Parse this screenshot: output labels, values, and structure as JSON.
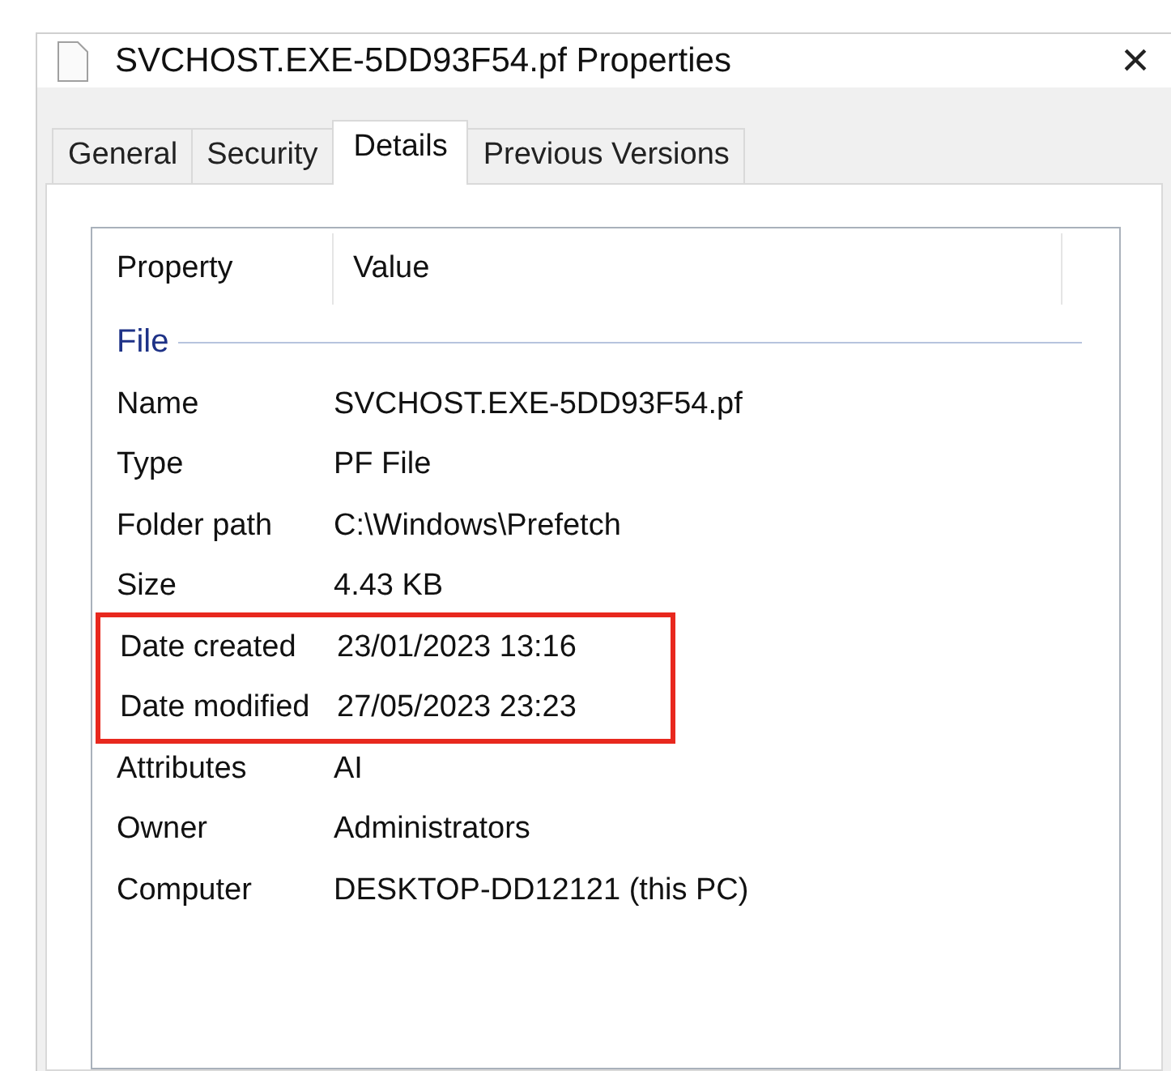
{
  "window": {
    "title": "SVCHOST.EXE-5DD93F54.pf Properties",
    "close": "×"
  },
  "tabs": [
    {
      "label": "General",
      "selected": false
    },
    {
      "label": "Security",
      "selected": false
    },
    {
      "label": "Details",
      "selected": true
    },
    {
      "label": "Previous Versions",
      "selected": false
    }
  ],
  "list": {
    "columns": [
      "Property",
      "Value"
    ],
    "group": "File",
    "rows": [
      {
        "property": "Name",
        "value": "SVCHOST.EXE-5DD93F54.pf",
        "highlighted": false
      },
      {
        "property": "Type",
        "value": "PF File",
        "highlighted": false
      },
      {
        "property": "Folder path",
        "value": "C:\\Windows\\Prefetch",
        "highlighted": false
      },
      {
        "property": "Size",
        "value": "4.43 KB",
        "highlighted": false
      },
      {
        "property": "Date created",
        "value": "23/01/2023 13:16",
        "highlighted": true
      },
      {
        "property": "Date modified",
        "value": "27/05/2023 23:23",
        "highlighted": true
      },
      {
        "property": "Attributes",
        "value": "AI",
        "highlighted": false
      },
      {
        "property": "Owner",
        "value": "Administrators",
        "highlighted": false
      },
      {
        "property": "Computer",
        "value": "DESKTOP-DD12121 (this PC)",
        "highlighted": false
      }
    ]
  }
}
